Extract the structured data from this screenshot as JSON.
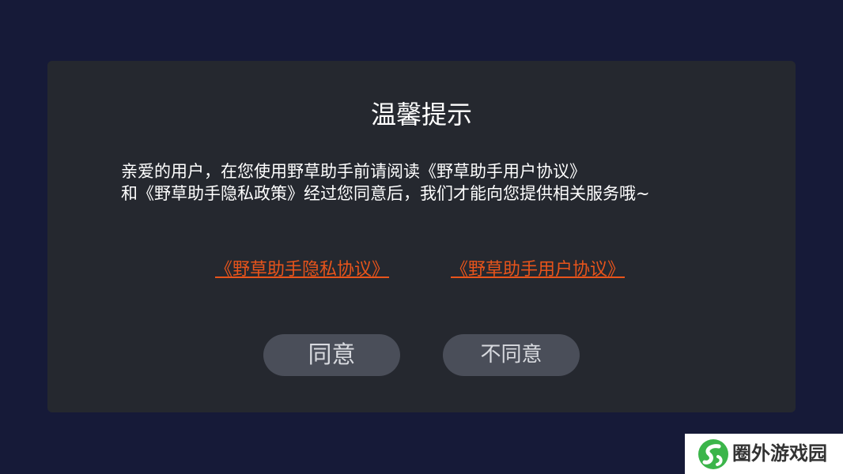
{
  "dialog": {
    "title": "温馨提示",
    "message_line1": "亲爱的用户，在您使用野草助手前请阅读《野草助手用户协议》",
    "message_line2": "和《野草助手隐私政策》经过您同意后，我们才能向您提供相关服务哦~",
    "link_privacy": "《野草助手隐私协议》",
    "link_user": "《野草助手用户协议》",
    "agree_label": "同意",
    "disagree_label": "不同意"
  },
  "watermark": {
    "text": "圈外游戏园",
    "logo_icon": "leaf-s-logo-icon"
  },
  "colors": {
    "background": "#161a38",
    "dialog": "#25282f",
    "link": "#e8541b",
    "button": "#4a4e59",
    "logo_green": "#3bb54a"
  }
}
